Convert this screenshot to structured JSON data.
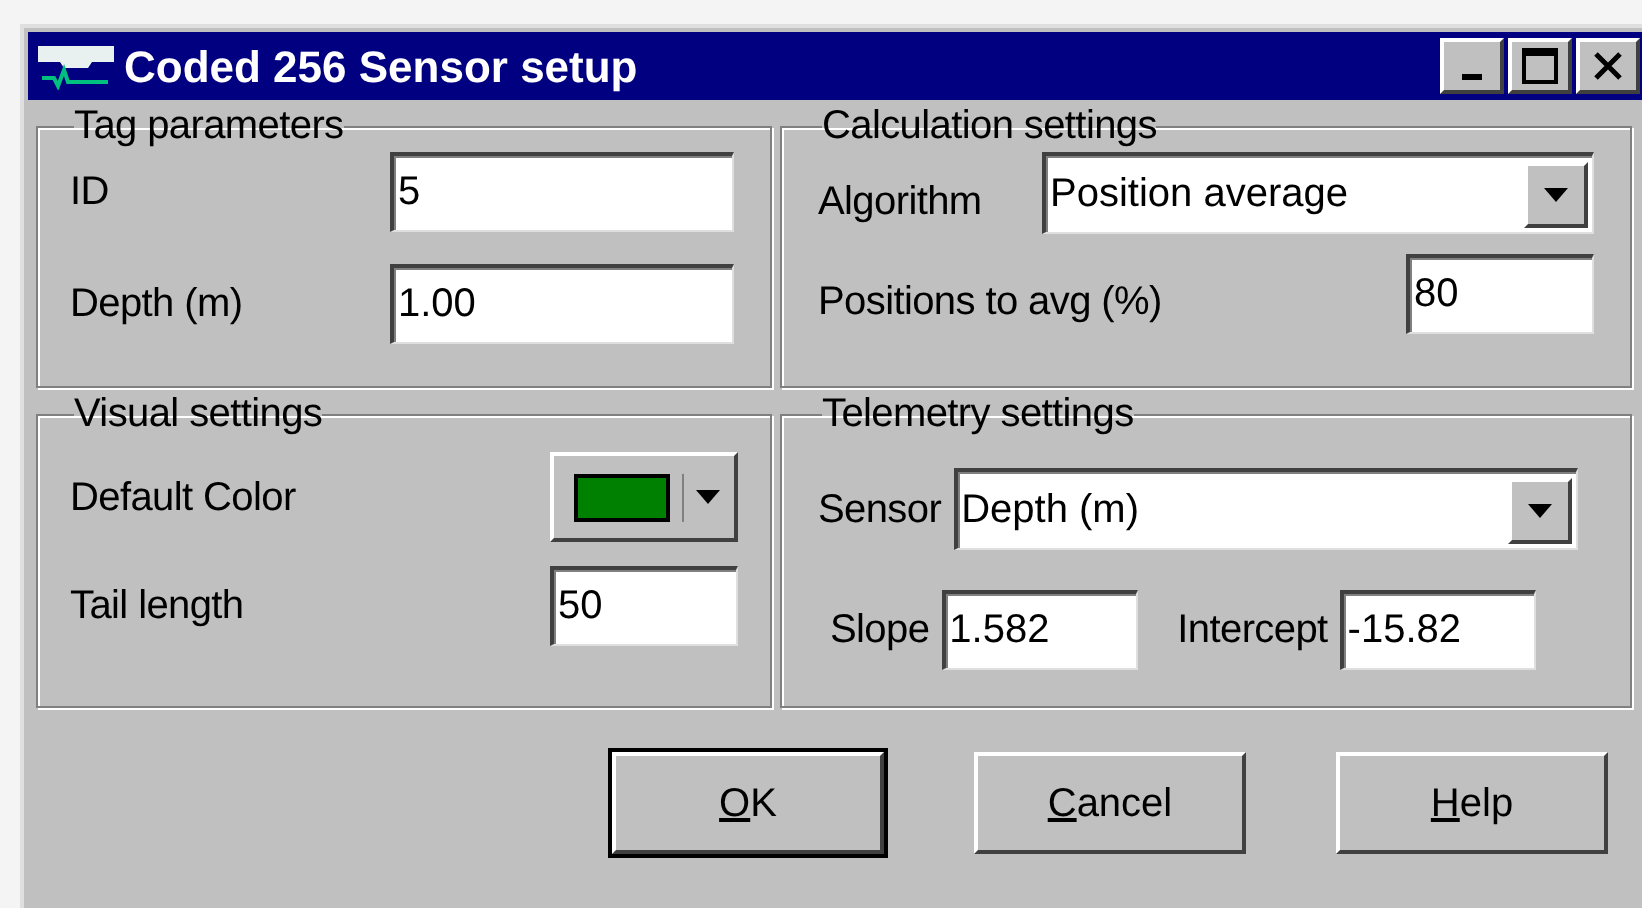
{
  "window": {
    "title": "Coded 256 Sensor setup"
  },
  "tag_parameters": {
    "title": "Tag parameters",
    "id": {
      "label": "ID",
      "value": "5"
    },
    "depth": {
      "label": "Depth (m)",
      "value": "1.00"
    }
  },
  "calculation_settings": {
    "title": "Calculation settings",
    "algorithm": {
      "label": "Algorithm",
      "value": "Position average"
    },
    "positions": {
      "label": "Positions to avg (%)",
      "value": "80"
    }
  },
  "visual_settings": {
    "title": "Visual settings",
    "default_color": {
      "label": "Default Color",
      "color": "#008000"
    },
    "tail_length": {
      "label": "Tail length",
      "value": "50"
    }
  },
  "telemetry_settings": {
    "title": "Telemetry settings",
    "sensor": {
      "label": "Sensor",
      "value": "Depth (m)"
    },
    "slope": {
      "label": "Slope",
      "value": "1.582"
    },
    "intercept": {
      "label": "Intercept",
      "value": "-15.82"
    }
  },
  "buttons": [
    {
      "accel": "O",
      "rest": "K",
      "default": true
    },
    {
      "accel": "C",
      "rest": "ancel",
      "default": false
    },
    {
      "accel": "H",
      "rest": "elp",
      "default": false
    }
  ]
}
